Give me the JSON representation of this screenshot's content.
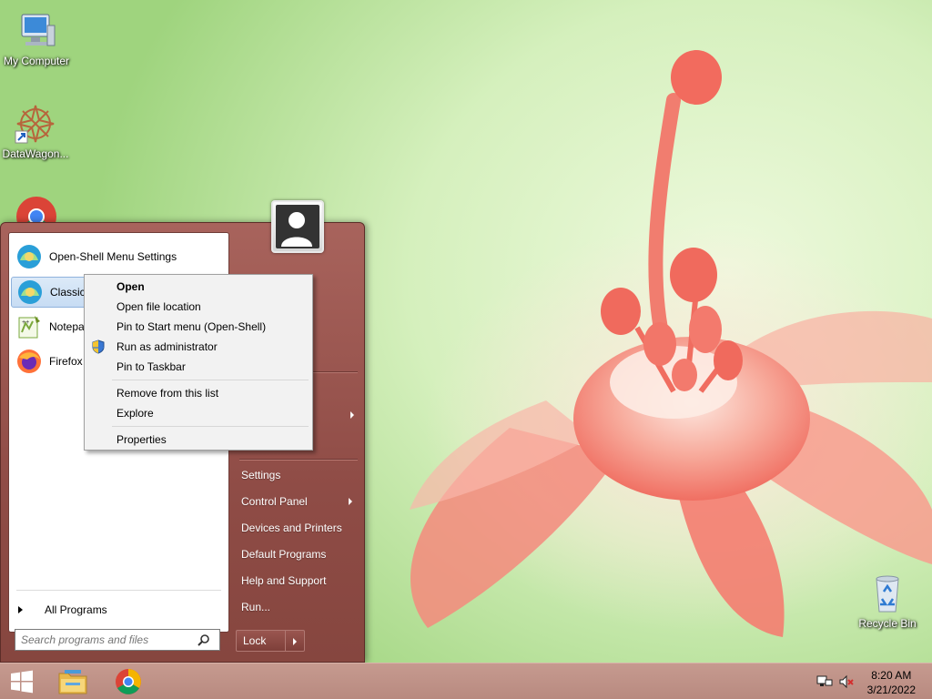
{
  "desktop": {
    "icons": [
      {
        "label": "My Computer",
        "icon": "my-computer-icon"
      },
      {
        "label": "DataWagon...",
        "icon": "datawagon-icon"
      },
      {
        "label": "Recycle Bin",
        "icon": "recycle-bin-icon"
      }
    ]
  },
  "start_menu": {
    "programs": [
      {
        "label": "Open-Shell Menu Settings",
        "icon": "open-shell-icon"
      },
      {
        "label": "Classic E",
        "icon": "open-shell-icon"
      },
      {
        "label": "Notepac",
        "icon": "notepad-plus-plus-icon"
      },
      {
        "label": "Firefox",
        "icon": "firefox-icon"
      }
    ],
    "all_programs_label": "All Programs",
    "search_placeholder": "Search programs and files",
    "right_items": [
      {
        "label": "Settings"
      },
      {
        "label": "Control Panel",
        "submenu": true
      },
      {
        "label": "Devices and Printers"
      },
      {
        "label": "Default Programs"
      },
      {
        "label": "Help and Support"
      },
      {
        "label": "Run..."
      }
    ],
    "lock_label": "Lock",
    "accent": "#98554f"
  },
  "context_menu": {
    "items": [
      {
        "label": "Open",
        "bold": true
      },
      {
        "label": "Open file location"
      },
      {
        "label": "Pin to Start menu (Open-Shell)"
      },
      {
        "label": "Run as administrator",
        "icon": "uac-shield-icon"
      },
      {
        "label": "Pin to Taskbar"
      },
      {
        "label": "Remove from this list"
      },
      {
        "label": "Explore"
      },
      {
        "label": "Properties"
      }
    ]
  },
  "taskbar": {
    "buttons": [
      {
        "icon": "windows-start-icon"
      },
      {
        "icon": "file-explorer-icon"
      },
      {
        "icon": "chrome-icon"
      }
    ],
    "tray": {
      "time": "8:20 AM",
      "date": "3/21/2022"
    },
    "color": "#c19489"
  }
}
